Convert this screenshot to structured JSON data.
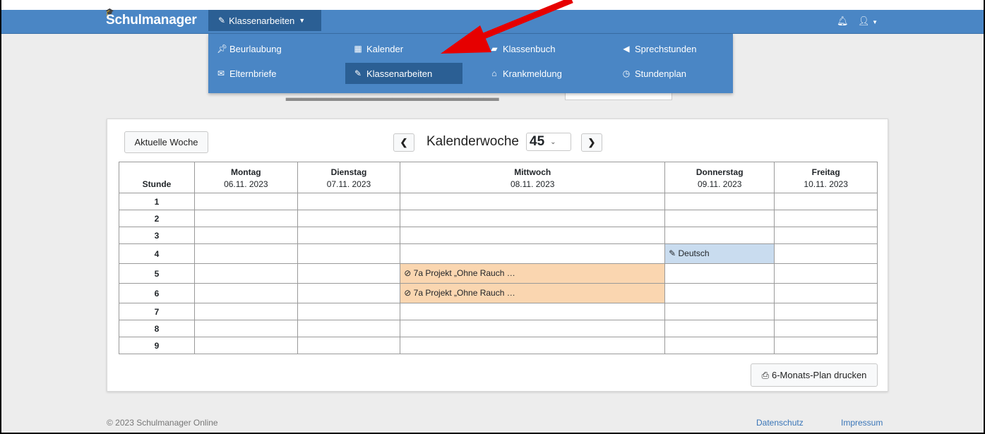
{
  "navbar": {
    "brand": "Schulmanager",
    "dropdown_label": "Klassenarbeiten",
    "bell_icon": "bell-icon",
    "user_icon": "user-icon"
  },
  "menu": {
    "items": [
      {
        "label": "Beurlaubung",
        "icon": "pin-icon"
      },
      {
        "label": "Kalender",
        "icon": "calendar-icon"
      },
      {
        "label": "Klassenbuch",
        "icon": "book-icon"
      },
      {
        "label": "Sprechstunden",
        "icon": "megaphone-icon"
      },
      {
        "label": "Elternbriefe",
        "icon": "envelope-icon"
      },
      {
        "label": "Klassenarbeiten",
        "icon": "edit-icon"
      },
      {
        "label": "Krankmeldung",
        "icon": "home-icon"
      },
      {
        "label": "Stundenplan",
        "icon": "clock-icon"
      }
    ]
  },
  "calendar": {
    "current_week_button": "Aktuelle Woche",
    "week_label": "Kalenderwoche",
    "week_number": "45",
    "stunde_header": "Stunde",
    "days": [
      {
        "name": "Montag",
        "date": "06.11. 2023"
      },
      {
        "name": "Dienstag",
        "date": "07.11. 2023"
      },
      {
        "name": "Mittwoch",
        "date": "08.11. 2023"
      },
      {
        "name": "Donnerstag",
        "date": "09.11. 2023"
      },
      {
        "name": "Freitag",
        "date": "10.11. 2023"
      }
    ],
    "periods": [
      "1",
      "2",
      "3",
      "4",
      "5",
      "6",
      "7",
      "8",
      "9"
    ],
    "entries": [
      {
        "period": "4",
        "day": "Donnerstag",
        "text": "Deutsch",
        "color": "#c9dcef"
      },
      {
        "period": "5",
        "day": "Mittwoch",
        "text": "7a Projekt „Ohne Rauch …",
        "color": "#fad6b0"
      },
      {
        "period": "6",
        "day": "Mittwoch",
        "text": "7a Projekt „Ohne Rauch …",
        "color": "#fad6b0"
      }
    ],
    "print_button": "6-Monats-Plan drucken"
  },
  "footer": {
    "copyright": "© 2023 Schulmanager Online",
    "privacy": "Datenschutz",
    "imprint": "Impressum"
  },
  "colors": {
    "navbar": "#4a86c5",
    "active": "#2b5f94",
    "arrow": "#e60000"
  }
}
